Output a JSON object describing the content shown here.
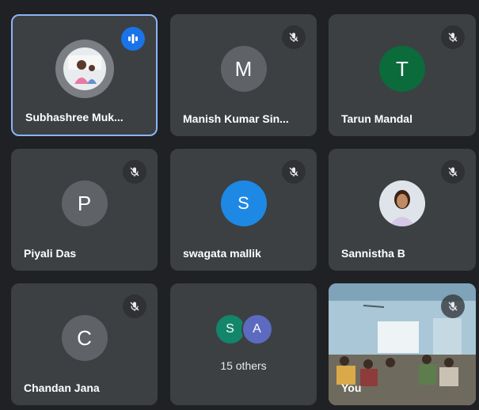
{
  "participants": [
    {
      "name": "Subhashree Muk...",
      "initial": "",
      "avatar_color": "#5f6368",
      "state": "speaking",
      "avatar_type": "photo"
    },
    {
      "name": "Manish Kumar Sin...",
      "initial": "M",
      "avatar_color": "#5f6368",
      "state": "muted"
    },
    {
      "name": "Tarun Mandal",
      "initial": "T",
      "avatar_color": "#0b6b3a",
      "state": "muted"
    },
    {
      "name": "Piyali Das",
      "initial": "P",
      "avatar_color": "#5f6368",
      "state": "muted"
    },
    {
      "name": "swagata mallik",
      "initial": "S",
      "avatar_color": "#1e88e5",
      "state": "muted"
    },
    {
      "name": "Sannistha B",
      "initial": "",
      "avatar_color": "#cfd8dc",
      "state": "muted",
      "avatar_type": "photo"
    },
    {
      "name": "Chandan Jana",
      "initial": "C",
      "avatar_color": "#5f6368",
      "state": "muted"
    }
  ],
  "others_tile": {
    "label": "15 others",
    "avatars": [
      {
        "initial": "S",
        "color": "#12856b"
      },
      {
        "initial": "A",
        "color": "#5c6bc0"
      }
    ]
  },
  "self_tile": {
    "name": "You",
    "state": "muted"
  },
  "icons": {
    "muted": "mic-off-icon",
    "speaking": "audio-bars-icon"
  },
  "colors": {
    "background": "#202124",
    "tile": "#3c4043",
    "active_border": "#8ab4f8"
  }
}
